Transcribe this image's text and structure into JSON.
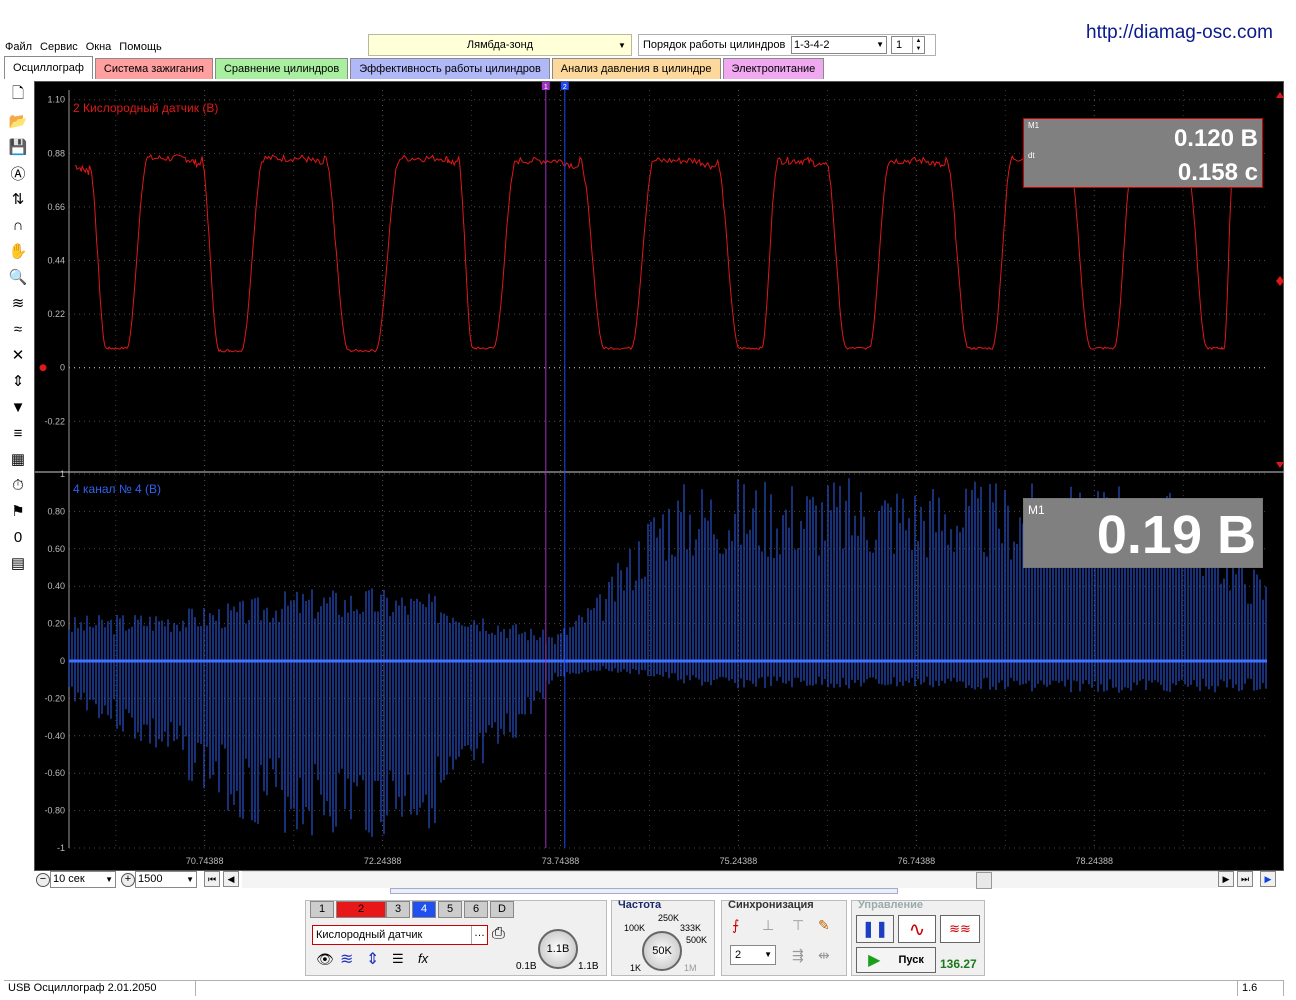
{
  "menu": [
    "Файл",
    "Сервис",
    "Окна",
    "Помощь"
  ],
  "url": "http://diamag-osc.com",
  "preset": {
    "value": "Лямбда-зонд"
  },
  "order": {
    "label": "Порядок работы цилиндров",
    "value": "1-3-4-2",
    "spin": "1"
  },
  "tabs": [
    {
      "label": "Осциллограф",
      "color": "#ffffff"
    },
    {
      "label": "Система зажигания",
      "color": "#ff9fa0"
    },
    {
      "label": "Сравнение цилиндров",
      "color": "#a8f0a0"
    },
    {
      "label": "Эффективность работы цилиндров",
      "color": "#b0b8f8"
    },
    {
      "label": "Анализ давления в цилиндре",
      "color": "#fcd89a"
    },
    {
      "label": "Электропитание",
      "color": "#f0a8f0"
    }
  ],
  "toolbar_icons": [
    "new-file-icon",
    "open-folder-icon",
    "save-icon",
    "auto-scale-icon",
    "cursor-measure-icon",
    "arc-icon",
    "hand-icon",
    "zoom-icon",
    "wave-overlay-icon",
    "wave-compare-icon",
    "wave-cross-icon",
    "level-icon",
    "filter-icon",
    "stack-icon",
    "table-icon",
    "auto-timer-icon",
    "flag-icon",
    "zero-marker-icon",
    "notes-icon"
  ],
  "toolbar_glyphs": [
    "🗋",
    "📂",
    "💾",
    "Ⓐ",
    "⇅",
    "∩",
    "✋",
    "🔍",
    "≋",
    "≈",
    "✕",
    "⇕",
    "▼",
    "≡",
    "▦",
    "⏱",
    "⚑",
    "0",
    "▤"
  ],
  "chart_data": [
    {
      "type": "line",
      "channel_title": "2 Кислородный датчик (В)",
      "color": "#e01818",
      "y_ticks": [
        "1.10",
        "0.88",
        "0.66",
        "0.44",
        "0.22",
        "0",
        "-0.22"
      ],
      "ylim": [
        -0.42,
        1.14
      ],
      "x_range": [
        69.6,
        79.7
      ],
      "cycles": [
        [
          69.65,
          0.83
        ],
        [
          70.0,
          0.08
        ],
        [
          70.58,
          0.86
        ],
        [
          70.96,
          0.07
        ],
        [
          71.58,
          0.86
        ],
        [
          72.08,
          0.07
        ],
        [
          72.77,
          0.86
        ],
        [
          73.08,
          0.08
        ],
        [
          73.73,
          0.85
        ],
        [
          74.24,
          0.08
        ],
        [
          74.89,
          0.85
        ],
        [
          75.37,
          0.08
        ],
        [
          75.83,
          0.85
        ],
        [
          76.26,
          0.08
        ],
        [
          76.83,
          0.85
        ],
        [
          77.3,
          0.08
        ],
        [
          77.86,
          0.86
        ],
        [
          78.33,
          0.08
        ],
        [
          78.87,
          0.86
        ],
        [
          79.3,
          0.08
        ],
        [
          79.55,
          0.8
        ]
      ],
      "measure": {
        "m1": "M1",
        "dt": "dt",
        "value1": "0.120 В",
        "value2": "0.158 с"
      }
    },
    {
      "type": "line",
      "channel_title": "4 канал № 4 (В)",
      "color": "#3060f0",
      "y_ticks": [
        "1",
        "0.80",
        "0.60",
        "0.40",
        "0.20",
        "0",
        "-0.20",
        "-0.40",
        "-0.60",
        "-0.80",
        "-1"
      ],
      "ylim": [
        -1,
        1
      ],
      "x_range": [
        69.6,
        79.7
      ],
      "envelope": [
        [
          69.6,
          0.24,
          -0.2
        ],
        [
          70.5,
          0.28,
          -0.6
        ],
        [
          71.0,
          0.32,
          -0.85
        ],
        [
          71.5,
          0.39,
          -0.95
        ],
        [
          72.2,
          0.4,
          -0.97
        ],
        [
          72.8,
          0.35,
          -0.88
        ],
        [
          73.3,
          0.22,
          -0.5
        ],
        [
          73.7,
          0.15,
          -0.1
        ],
        [
          74.1,
          0.38,
          -0.05
        ],
        [
          74.6,
          0.95,
          -0.1
        ],
        [
          75.0,
          1.0,
          -0.15
        ],
        [
          76.0,
          1.0,
          -0.15
        ],
        [
          77.0,
          0.98,
          -0.15
        ],
        [
          78.0,
          0.95,
          -0.17
        ],
        [
          79.0,
          0.92,
          -0.17
        ],
        [
          79.7,
          0.45,
          -0.17
        ]
      ],
      "measure": {
        "m1": "M1",
        "value1": "0.19 В"
      }
    }
  ],
  "x_axis_ticks": [
    {
      "v": 70.74388,
      "label": "70.74388"
    },
    {
      "v": 72.24388,
      "label": "72.24388"
    },
    {
      "v": 73.74388,
      "label": "73.74388"
    },
    {
      "v": 75.24388,
      "label": "75.24388"
    },
    {
      "v": 76.74388,
      "label": "76.74388"
    },
    {
      "v": 78.24388,
      "label": "78.24388"
    }
  ],
  "cursors": [
    {
      "v": 73.62,
      "color": "#a030c0",
      "label": "1"
    },
    {
      "v": 73.78,
      "color": "#2048f0",
      "label": "2"
    }
  ],
  "bottom": {
    "time_per_div": "10 сек",
    "points": "1500"
  },
  "channels": {
    "buttons": [
      "1",
      "2",
      "3",
      "4",
      "5",
      "6",
      "D"
    ],
    "active_red": "2",
    "active_blue": "4",
    "sensor": "Кислородный датчик",
    "knob": "1.1В",
    "knob_min": "0.1В",
    "knob_max": "1.1В"
  },
  "frequency": {
    "title": "Частота",
    "labels": [
      "250K",
      "100K",
      "333K",
      "500K",
      "1K",
      "1M"
    ],
    "knob": "50K"
  },
  "sync": {
    "title": "Синхронизация",
    "value": "2"
  },
  "control": {
    "title": "Управление",
    "start": "Пуск",
    "rate": "136.27"
  },
  "status": {
    "app": "USB Осциллограф  2.01.2050",
    "version": "1.6"
  }
}
